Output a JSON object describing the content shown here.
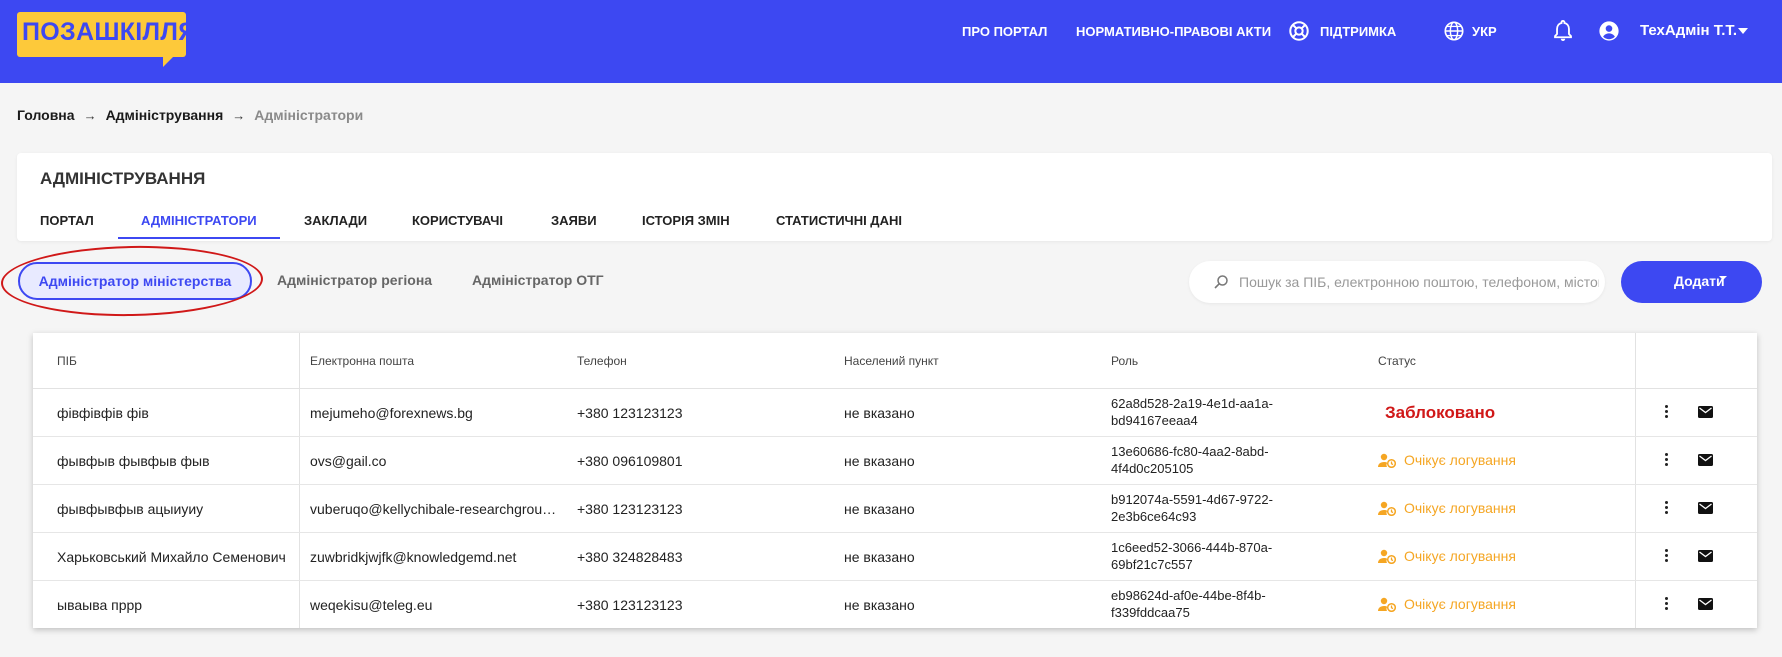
{
  "logo": {
    "text": "ПОЗАШКІЛЛЯ"
  },
  "nav": {
    "about": "ПРО ПОРТАЛ",
    "legal": "НОРМАТИВНО-ПРАВОВІ АКТИ",
    "support": "ПІДТРИМКА",
    "language": "УКР",
    "username": "ТехАдмін Т.Т."
  },
  "breadcrumb": [
    "Головна",
    "Адміністрування",
    "Адміністратори"
  ],
  "admin": {
    "title": "АДМІНІСТРУВАННЯ",
    "tabs": [
      "ПОРТАЛ",
      "АДМІНІСТРАТОРИ",
      "ЗАКЛАДИ",
      "КОРИСТУВАЧІ",
      "ЗАЯВИ",
      "ІСТОРІЯ ЗМІН",
      "СТАТИСТИЧНІ ДАНІ"
    ],
    "active_tab": "АДМІНІСТРАТОРИ"
  },
  "subtabs": [
    "Адміністратор міністерства",
    "Адміністратор регіона",
    "Адміністратор ОТГ"
  ],
  "active_subtab": "Адміністратор міністерства",
  "search": {
    "placeholder": "Пошук за ПІБ, електронною поштою, телефоном, містом",
    "value": ""
  },
  "add_button": {
    "label": "Додати"
  },
  "table": {
    "headers": [
      "ПІБ",
      "Електронна пошта",
      "Телефон",
      "Населений пункт",
      "Роль",
      "Статус"
    ],
    "rows": [
      {
        "name": "фівфівфів фів",
        "email": "mejumeho@forexnews.bg",
        "phone": "+380 123123123",
        "city": "не вказано",
        "role": "62a8d528-2a19-4e1d-aa1a-bd94167eeaa4",
        "status": "Заблоковано",
        "status_type": "blocked"
      },
      {
        "name": "фывфыв фывфыв фыв",
        "email": "ovs@gail.co",
        "phone": "+380 096109801",
        "city": "не вказано",
        "role": "13e60686-fc80-4aa2-8abd-4f4d0c205105",
        "status": "Очікує логування",
        "status_type": "pending"
      },
      {
        "name": "фывфывфыв ацыиуиу",
        "email": "vuberuqo@kellychibale-researchgroup-uct.com",
        "phone": "+380 123123123",
        "city": "не вказано",
        "role": "b912074a-5591-4d67-9722-2e3b6ce64c93",
        "status": "Очікує логування",
        "status_type": "pending"
      },
      {
        "name": "Харьковський Михайло Семенович",
        "email": "zuwbridkjwjfk@knowledgemd.net",
        "phone": "+380 324828483",
        "city": "не вказано",
        "role": "1c6eed52-3066-444b-870a-69bf21c7c557",
        "status": "Очікує логування",
        "status_type": "pending"
      },
      {
        "name": "ываыва пррр",
        "email": "weqekisu@teleg.eu",
        "phone": "+380 123123123",
        "city": "не вказано",
        "role": "eb98624d-af0e-44be-8f4b-f339fddcaa75",
        "status": "Очікує логування",
        "status_type": "pending"
      }
    ]
  },
  "colors": {
    "primary": "#3d48f2",
    "logo_bg": "#fdc93a",
    "blocked": "#d01818",
    "pending": "#f5a623"
  }
}
